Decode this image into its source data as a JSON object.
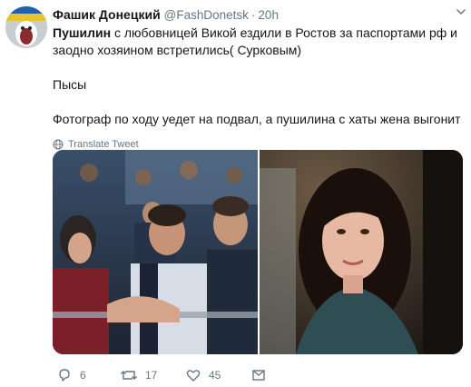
{
  "tweet": {
    "author_name": "Фашик Донецкий",
    "author_handle": "@FashDonetsk",
    "separator": "·",
    "time": "20h",
    "text_bold": "Пушилин",
    "text_line1": " с любовницей Викой ездили в Ростов за паспортами рф и заодно хозяином встретились( Сурковым)",
    "text_line2": "Пысы",
    "text_line3": "Фотограф по ходу уедет на подвал, а пушилина с хаты жена выгонит",
    "translate_label": "Translate Tweet"
  },
  "actions": {
    "reply_count": "6",
    "retweet_count": "17",
    "like_count": "45",
    "reply_icon": "reply-icon",
    "retweet_icon": "retweet-icon",
    "like_icon": "heart-icon",
    "share_icon": "share-icon"
  },
  "colors": {
    "text": "#14171a",
    "secondary": "#657786",
    "background": "#ffffff"
  }
}
